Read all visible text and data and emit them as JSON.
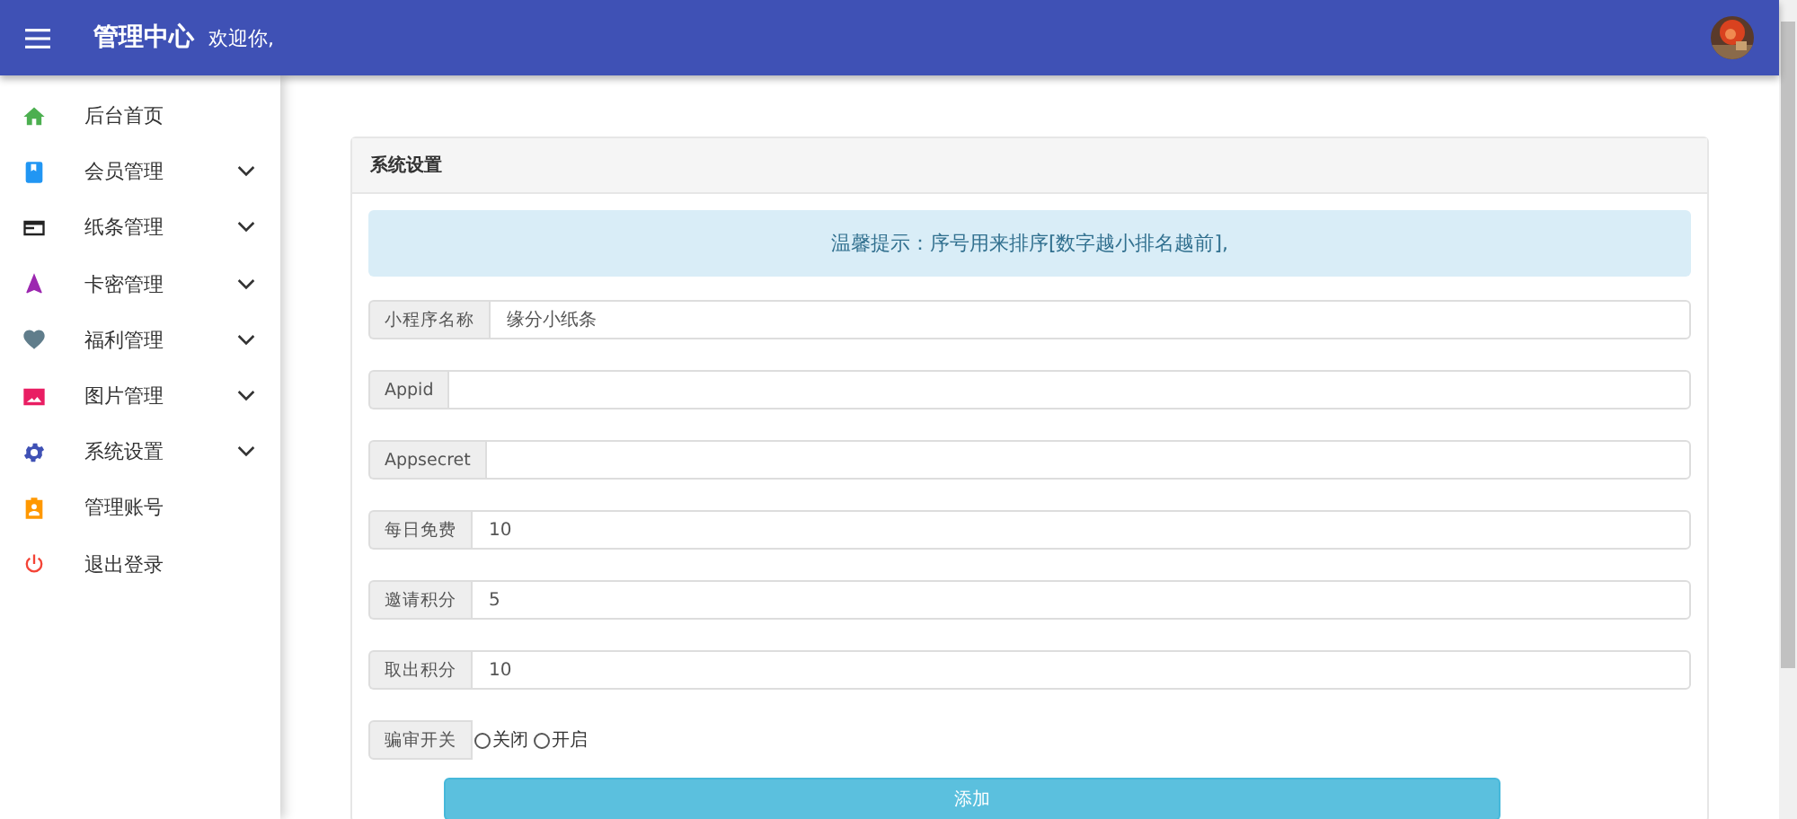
{
  "header": {
    "title": "管理中心",
    "greeting": "欢迎你,"
  },
  "sidebar": {
    "items": [
      {
        "label": "后台首页",
        "expandable": false
      },
      {
        "label": "会员管理",
        "expandable": true
      },
      {
        "label": "纸条管理",
        "expandable": true
      },
      {
        "label": "卡密管理",
        "expandable": true
      },
      {
        "label": "福利管理",
        "expandable": true
      },
      {
        "label": "图片管理",
        "expandable": true
      },
      {
        "label": "系统设置",
        "expandable": true
      },
      {
        "label": "管理账号",
        "expandable": false
      },
      {
        "label": "退出登录",
        "expandable": false
      }
    ]
  },
  "card": {
    "title": "系统设置",
    "notice": "温馨提示：序号用来排序[数字越小排名越前],",
    "fields": [
      {
        "label": "小程序名称",
        "value": "缘分小纸条"
      },
      {
        "label": "Appid"
      },
      {
        "label": "Appsecret"
      },
      {
        "label": "每日免费",
        "value": "10"
      },
      {
        "label": "邀请积分",
        "value": "5"
      },
      {
        "label": "取出积分",
        "value": "10"
      }
    ],
    "switch": {
      "label": "骗审开关",
      "options": [
        {
          "label": "关闭",
          "selected": false
        },
        {
          "label": "开启",
          "selected": false
        }
      ]
    },
    "submit": "添加"
  }
}
